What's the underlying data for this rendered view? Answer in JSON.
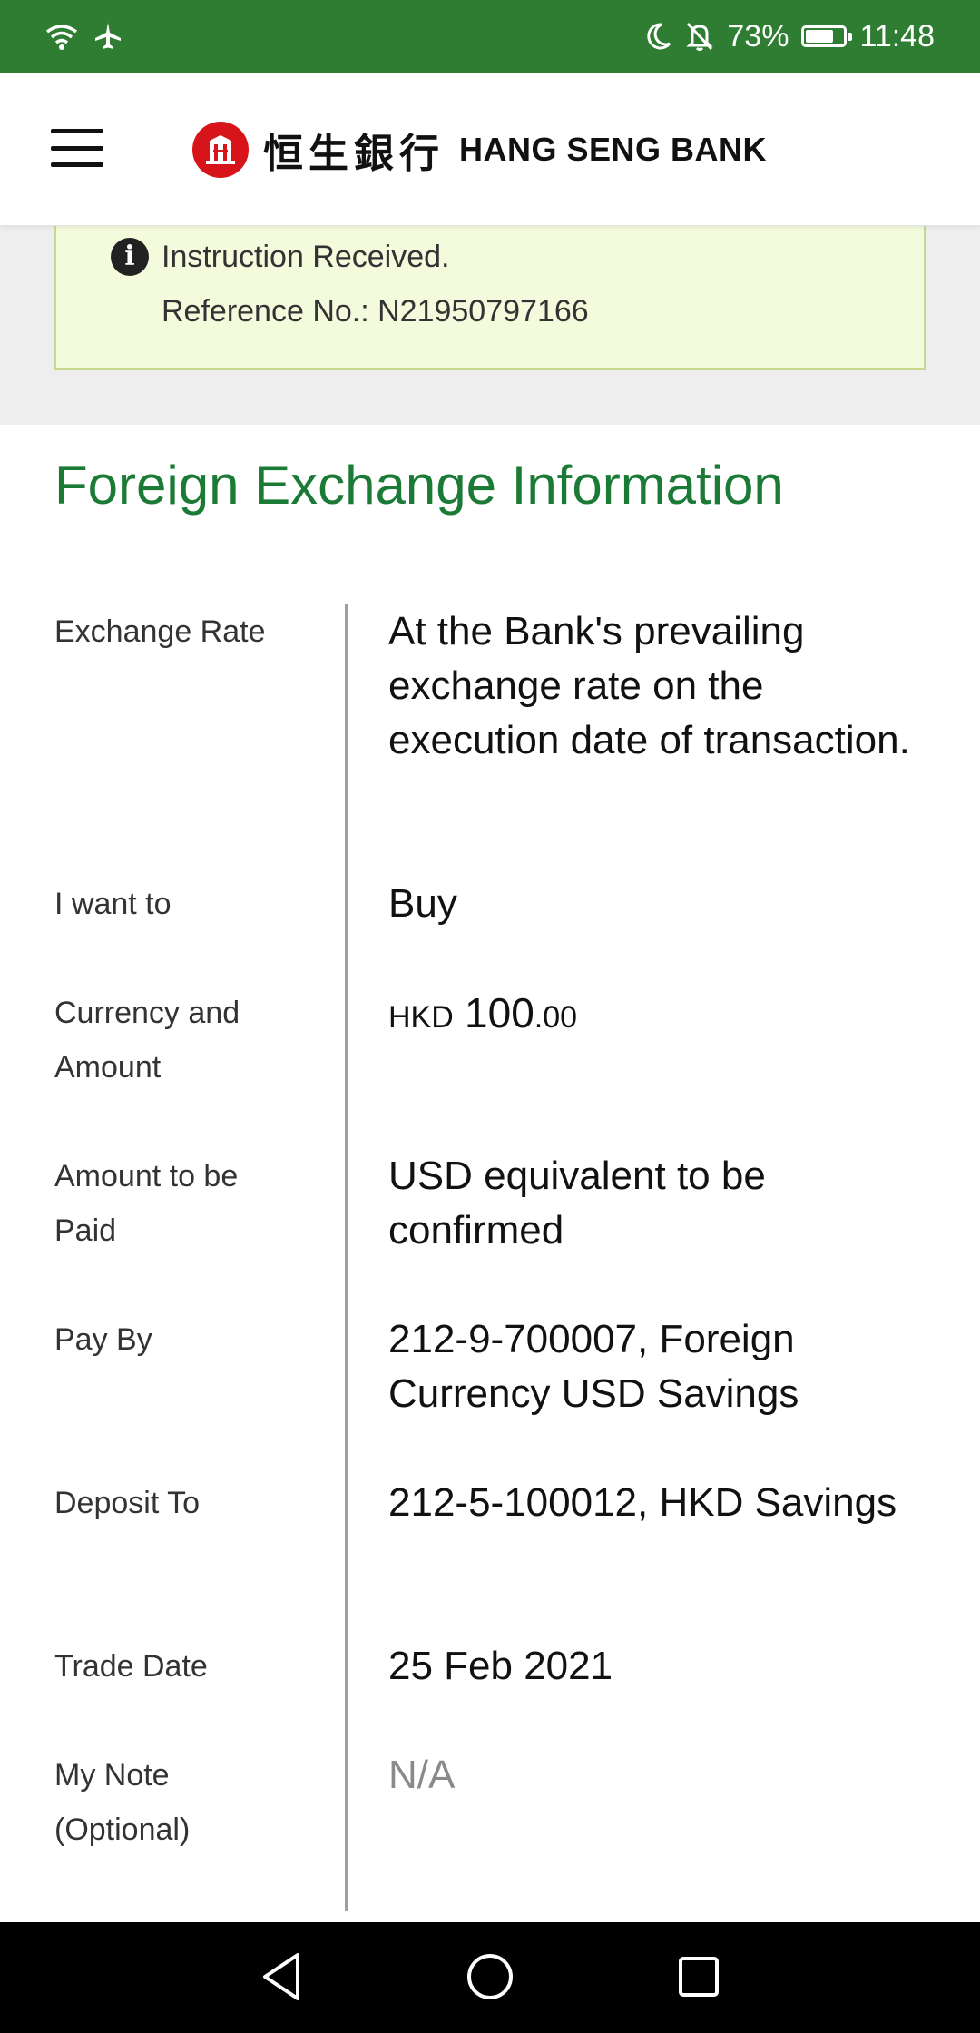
{
  "status_bar": {
    "battery": "73%",
    "time": "11:48",
    "battery_level": 0.73,
    "icons": [
      "wifi-icon",
      "airplane-icon",
      "moon-icon",
      "bell-muted-icon",
      "battery-icon"
    ]
  },
  "header": {
    "logo_cn": "恒生銀行",
    "logo_en": "HANG SENG BANK",
    "brand_color": "#d7141a"
  },
  "notice": {
    "line1": "Instruction Received.",
    "line2": "Reference No.: N21950797166"
  },
  "main": {
    "title": "Foreign Exchange Information",
    "rows": [
      {
        "label": "Exchange Rate",
        "value": "At the Bank's prevailing exchange rate on the execution date of transaction."
      },
      {
        "label": "I want to",
        "value": "Buy"
      },
      {
        "label": "Currency and Amount",
        "currency": "HKD",
        "amount_int": "100",
        "amount_dec": ".00"
      },
      {
        "label": "Amount to be Paid",
        "value": "USD equivalent to be confirmed"
      },
      {
        "label": "Pay By",
        "value": "212-9-700007, Foreign Currency USD Savings"
      },
      {
        "label": "Deposit To",
        "value": "212-5-100012, HKD Savings"
      },
      {
        "label": "Trade Date",
        "value": "25 Feb 2021"
      },
      {
        "label": "My Note (Optional)",
        "value": "N/A"
      }
    ]
  },
  "colors": {
    "status_bar": "#2e7d32",
    "title_green": "#1b7a35",
    "notice_bg": "#f4fadc"
  }
}
